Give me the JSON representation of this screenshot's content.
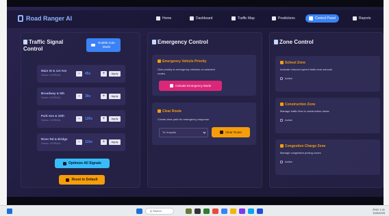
{
  "app": {
    "title": "Road Ranger AI"
  },
  "nav": [
    {
      "label": "Home",
      "icon": "home-icon"
    },
    {
      "label": "Dashboard",
      "icon": "dashboard-icon"
    },
    {
      "label": "Traffic Map",
      "icon": "car-icon"
    },
    {
      "label": "Predictions",
      "icon": "chart-icon"
    },
    {
      "label": "Control Panel",
      "icon": "control-icon",
      "active": true
    },
    {
      "label": "Reports",
      "icon": "report-icon"
    }
  ],
  "traffic_signal": {
    "title": "Traffic Signal Control",
    "title_line1": "Traffic Signal",
    "title_line2": "Control",
    "enable_button": "Enable Auto Mode",
    "signals": [
      {
        "name": "Main St & 1st Ave",
        "sub": "Status: NORMAL",
        "value": "45s",
        "apply": "Apply"
      },
      {
        "name": "Broadway & 5th",
        "sub": "Status: NORMAL",
        "value": "30s",
        "apply": "Apply"
      },
      {
        "name": "Park Ave & 10th",
        "sub": "Status: NORMAL",
        "value": "120s",
        "apply": "Apply"
      },
      {
        "name": "River Rd & Bridge",
        "sub": "Status: NORMAL",
        "value": "115s",
        "apply": "Apply"
      }
    ],
    "optimize_button": "Optimize All Signals",
    "reset_button": "Reset to Default"
  },
  "emergency": {
    "title": "Emergency Control",
    "priority": {
      "heading": "Emergency Vehicle Priority",
      "text_line1": "Give priority to emergency vehicles on selected",
      "text_line2": "routes",
      "button": "Activate Emergency Mode"
    },
    "clear_route": {
      "heading": "Clear Route",
      "text": "Create clear path for emergency response",
      "select_value": "To Hospital",
      "button": "Clear Route"
    }
  },
  "zone": {
    "title": "Zone Control",
    "zones": [
      {
        "heading": "School Zone",
        "text": "Activate reduced speed limits near schools",
        "checkbox": "Active"
      },
      {
        "heading": "Construction Zone",
        "text": "Manage traffic flow in construction areas",
        "checkbox": "Active"
      },
      {
        "heading": "Congestion Charge Zone",
        "text": "Manage congestion pricing zones",
        "checkbox": "Active"
      }
    ]
  },
  "taskbar": {
    "search": "Q Search",
    "time": "1:41",
    "date": "10/6/2025",
    "tray": "ENG"
  },
  "colors": {
    "accent": "#3b82f6",
    "warning": "#f59e0b",
    "emergency": "#db2777",
    "cyan": "#38bdf8"
  }
}
